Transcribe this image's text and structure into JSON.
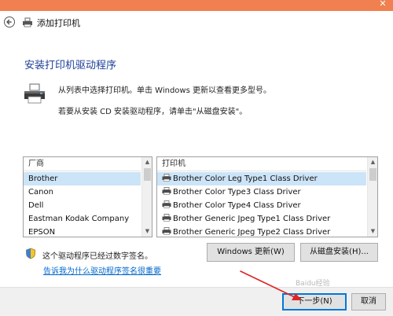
{
  "window": {
    "title": "添加打印机",
    "close_glyph": "✕"
  },
  "page": {
    "title": "安装打印机驱动程序",
    "desc_line1": "从列表中选择打印机。单击 Windows 更新以查看更多型号。",
    "desc_line2": "若要从安装 CD 安装驱动程序，请单击\"从磁盘安装\"。"
  },
  "manufacturers": {
    "header": "厂商",
    "selected_index": 0,
    "items": [
      "Brother",
      "Canon",
      "Dell",
      "Eastman Kodak Company",
      "EPSON"
    ]
  },
  "printers": {
    "header": "打印机",
    "selected_index": 0,
    "items": [
      "Brother Color Leg Type1 Class Driver",
      "Brother Color Type3 Class Driver",
      "Brother Color Type4 Class Driver",
      "Brother Generic Jpeg Type1 Class Driver",
      "Brother Generic Jpeg Type2 Class Driver"
    ]
  },
  "signature": {
    "text": "这个驱动程序已经过数字签名。",
    "link": "告诉我为什么驱动程序签名很重要"
  },
  "buttons": {
    "windows_update": "Windows 更新(W)",
    "have_disk": "从磁盘安装(H)...",
    "next": "下一步(N)",
    "cancel": "取消"
  },
  "watermark": "Baidu经验",
  "colors": {
    "titlebar": "#f0804f",
    "title_text": "#1d3f98",
    "selection": "#cce4f7",
    "link": "#0066cc",
    "annotation_arrow": "#e02424"
  },
  "icons": {
    "back": "back-arrow-icon",
    "printer": "printer-icon",
    "shield": "shield-icon"
  }
}
